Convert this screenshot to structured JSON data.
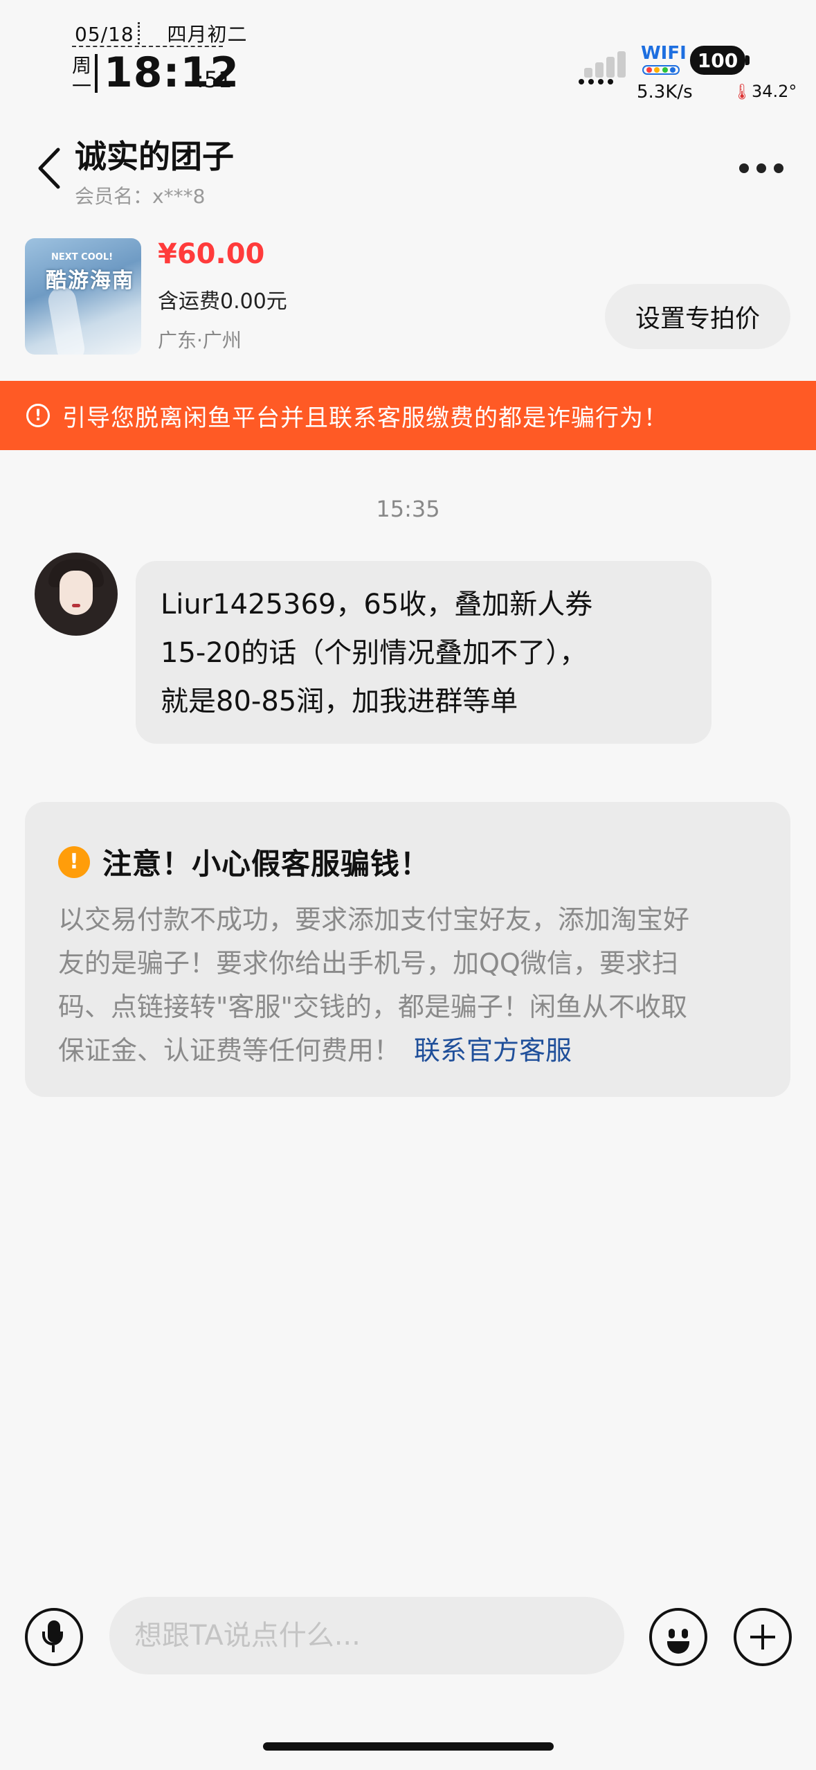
{
  "status_bar": {
    "date": "05/18",
    "lunar": "四月初二",
    "weekday": "周一",
    "time": "18:12",
    "seconds": ":51",
    "wifi_label": "WIFI",
    "speed": "5.3K/s",
    "battery": "100",
    "temperature": "34.2°"
  },
  "header": {
    "title": "诚实的团子",
    "member": "会员名：x***8"
  },
  "product": {
    "thumb_small": "NEXT COOL!",
    "thumb_title": "酷游海南",
    "price": "¥60.00",
    "shipping": "含运费0.00元",
    "location": "广东·广州",
    "set_price_label": "设置专拍价"
  },
  "banner": {
    "icon": "!",
    "text": "引导您脱离闲鱼平台并且联系客服缴费的都是诈骗行为！"
  },
  "chat": {
    "timestamp": "15:35",
    "message_lines": [
      "Liur1425369，65收，叠加新人券",
      "15-20的话（个别情况叠加不了），",
      "就是80-85润，加我进群等单"
    ]
  },
  "notice": {
    "icon": "!",
    "title": "注意！小心假客服骗钱！",
    "body_lines": [
      "以交易付款不成功，要求添加支付宝好友，添加淘宝好",
      "友的是骗子！要求你给出手机号，加QQ微信，要求扫",
      "码、点链接转\"客服\"交钱的，都是骗子！闲鱼从不收取",
      "保证金、认证费等任何费用！"
    ],
    "link": "联系官方客服"
  },
  "input_bar": {
    "placeholder": "想跟TA说点什么..."
  },
  "colors": {
    "accent_red": "#ff3b3b",
    "banner_orange": "#ff5a25",
    "notice_warning": "#ff9d0a",
    "link_blue": "#1f4f9a"
  }
}
